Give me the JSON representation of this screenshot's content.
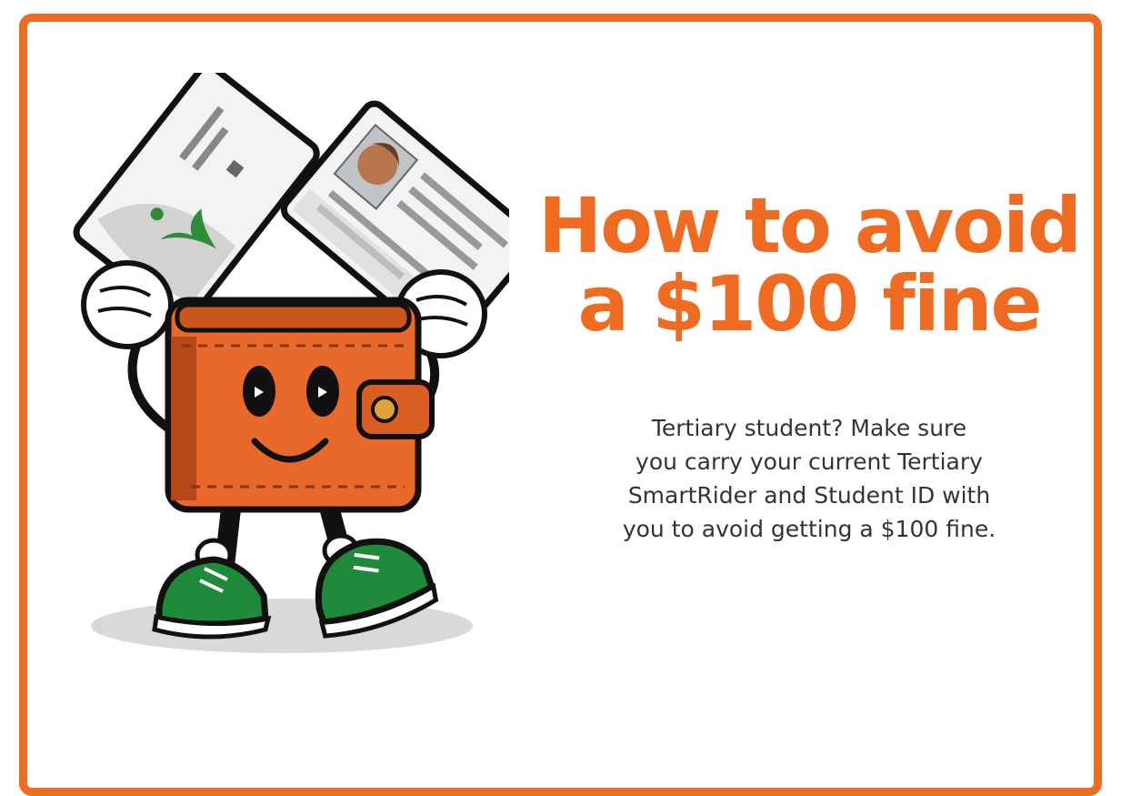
{
  "headline": {
    "line1": "How to avoid",
    "line2": "a $100 fine"
  },
  "body": {
    "line1": "Tertiary student? Make sure",
    "line2": "you carry your current Tertiary",
    "line3": "SmartRider and Student ID with",
    "line4": "you to avoid getting a $100 fine."
  },
  "illustration": {
    "subject": "wallet-mascot",
    "props": [
      "smartrider-card-icon",
      "student-id-card-icon"
    ]
  },
  "colors": {
    "accent": "#ef6b22",
    "wallet": "#e8692a",
    "sneaker": "#1f8a3a",
    "logo_green": "#2e8b3a",
    "body_text": "#333333"
  }
}
